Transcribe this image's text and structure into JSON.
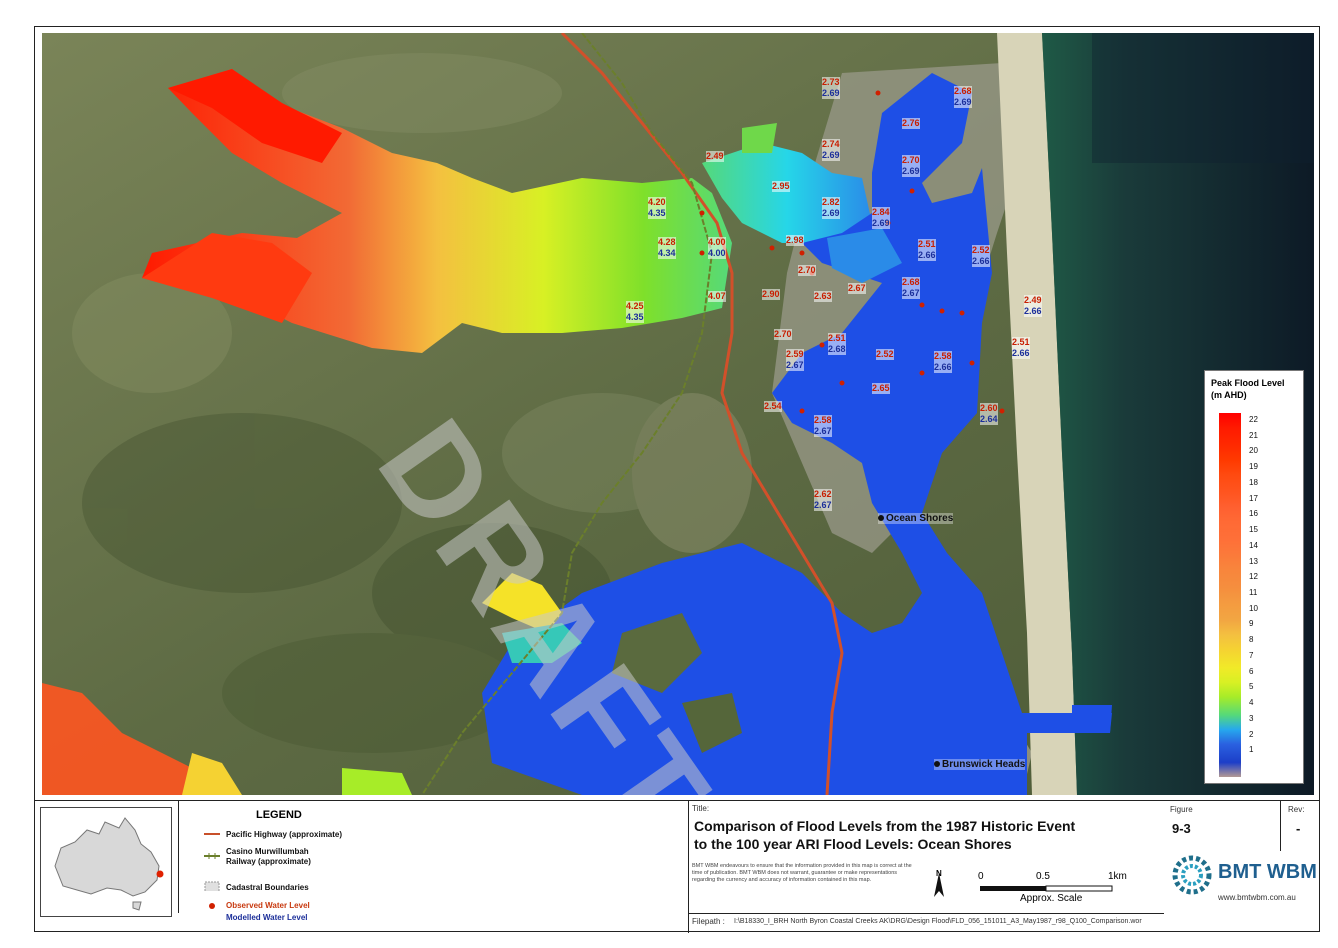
{
  "map": {
    "places": [
      {
        "id": "ocean-shores",
        "name": "Ocean Shores"
      },
      {
        "id": "brunswick-heads",
        "name": "Brunswick Heads"
      }
    ],
    "watermark": "DRAFT",
    "level_labels": [
      {
        "obs": "2.73",
        "mod": "2.69"
      },
      {
        "obs": "2.68",
        "mod": "2.69"
      },
      {
        "obs": "2.76",
        "mod": ""
      },
      {
        "obs": "2.74",
        "mod": "2.69"
      },
      {
        "obs": "2.70",
        "mod": "2.69"
      },
      {
        "obs": "2.49",
        "mod": ""
      },
      {
        "obs": "2.95",
        "mod": ""
      },
      {
        "obs": "4.20",
        "mod": "4.35"
      },
      {
        "obs": "2.82",
        "mod": "2.69"
      },
      {
        "obs": "2.84",
        "mod": "2.69"
      },
      {
        "obs": "4.28",
        "mod": "4.34"
      },
      {
        "obs": "4.00",
        "mod": "4.00"
      },
      {
        "obs": "2.98",
        "mod": ""
      },
      {
        "obs": "2.51",
        "mod": "2.66"
      },
      {
        "obs": "2.52",
        "mod": "2.66"
      },
      {
        "obs": "2.70",
        "mod": ""
      },
      {
        "obs": "2.68",
        "mod": "2.67"
      },
      {
        "obs": "4.07",
        "mod": ""
      },
      {
        "obs": "2.90",
        "mod": ""
      },
      {
        "obs": "2.63",
        "mod": ""
      },
      {
        "obs": "2.67",
        "mod": ""
      },
      {
        "obs": "2.49",
        "mod": "2.66"
      },
      {
        "obs": "4.25",
        "mod": "4.35"
      },
      {
        "obs": "2.70",
        "mod": ""
      },
      {
        "obs": "2.51",
        "mod": "2.68"
      },
      {
        "obs": "2.51",
        "mod": "2.66"
      },
      {
        "obs": "2.59",
        "mod": "2.67"
      },
      {
        "obs": "2.52",
        "mod": ""
      },
      {
        "obs": "2.58",
        "mod": "2.66"
      },
      {
        "obs": "2.65",
        "mod": ""
      },
      {
        "obs": "2.54",
        "mod": ""
      },
      {
        "obs": "2.60",
        "mod": "2.64"
      },
      {
        "obs": "2.58",
        "mod": "2.67"
      },
      {
        "obs": "2.62",
        "mod": "2.67"
      }
    ]
  },
  "colorbar": {
    "title_line1": "Peak Flood Level",
    "title_line2": "(m AHD)",
    "ticks": [
      "22",
      "21",
      "20",
      "19",
      "18",
      "17",
      "16",
      "15",
      "14",
      "13",
      "12",
      "11",
      "10",
      "9",
      "8",
      "7",
      "6",
      "5",
      "4",
      "3",
      "2",
      "1"
    ],
    "colors": [
      "#ff0000",
      "#ff1a00",
      "#ff2a00",
      "#ff3a00",
      "#ff4a10",
      "#ff5520",
      "#ff6030",
      "#ff6a35",
      "#fe7038",
      "#fb7a3a",
      "#f8853c",
      "#f58e3e",
      "#f49a40",
      "#f2a642",
      "#f4c040",
      "#f5d232",
      "#f1ea28",
      "#d8f024",
      "#a7ec28",
      "#55d97a",
      "#26a8ee",
      "#2a61e0",
      "#1c3ec8",
      "#b39a94"
    ]
  },
  "legend": {
    "title": "LEGEND",
    "items": [
      {
        "label": "Pacific Highway (approximate)"
      },
      {
        "label": "Casino Murwillumbah Railway (approximate)"
      },
      {
        "label": "Cadastral Boundaries"
      },
      {
        "label": "Observed Water Level"
      },
      {
        "label": "Modelled Water Level"
      }
    ],
    "colors": {
      "highway": "#c8502a",
      "railway": "#6b7f2b",
      "observed": "#d02000",
      "modelled": "#1c2f9a"
    }
  },
  "title_block": {
    "label": "Title:",
    "title_line1": "Comparison of Flood Levels from the 1987 Historic Event",
    "title_line2": "to the 100 year ARI Flood Levels: Ocean Shores",
    "disclaimer": "BMT WBM endeavours to ensure that the information provided in this map is correct at the time of publication. BMT WBM does not warrant, guarantee or make representations regarding the currency and accuracy of information contained in this map.",
    "scale_labels": [
      "0",
      "0.5",
      "1km"
    ],
    "scale_caption": "Approx. Scale",
    "north": "N"
  },
  "figure": {
    "figure_label": "Figure",
    "figure_value": "9-3",
    "rev_label": "Rev:",
    "rev_value": "-"
  },
  "logo": {
    "name": "BMT WBM",
    "url": "www.bmtwbm.com.au"
  },
  "filepath": {
    "label": "Filepath :",
    "value": "I:\\B18330_I_BRH North Byron Coastal Creeks AK\\DRG\\Design Flood\\FLD_056_151011_A3_May1987_r98_Q100_Comparison.wor"
  }
}
